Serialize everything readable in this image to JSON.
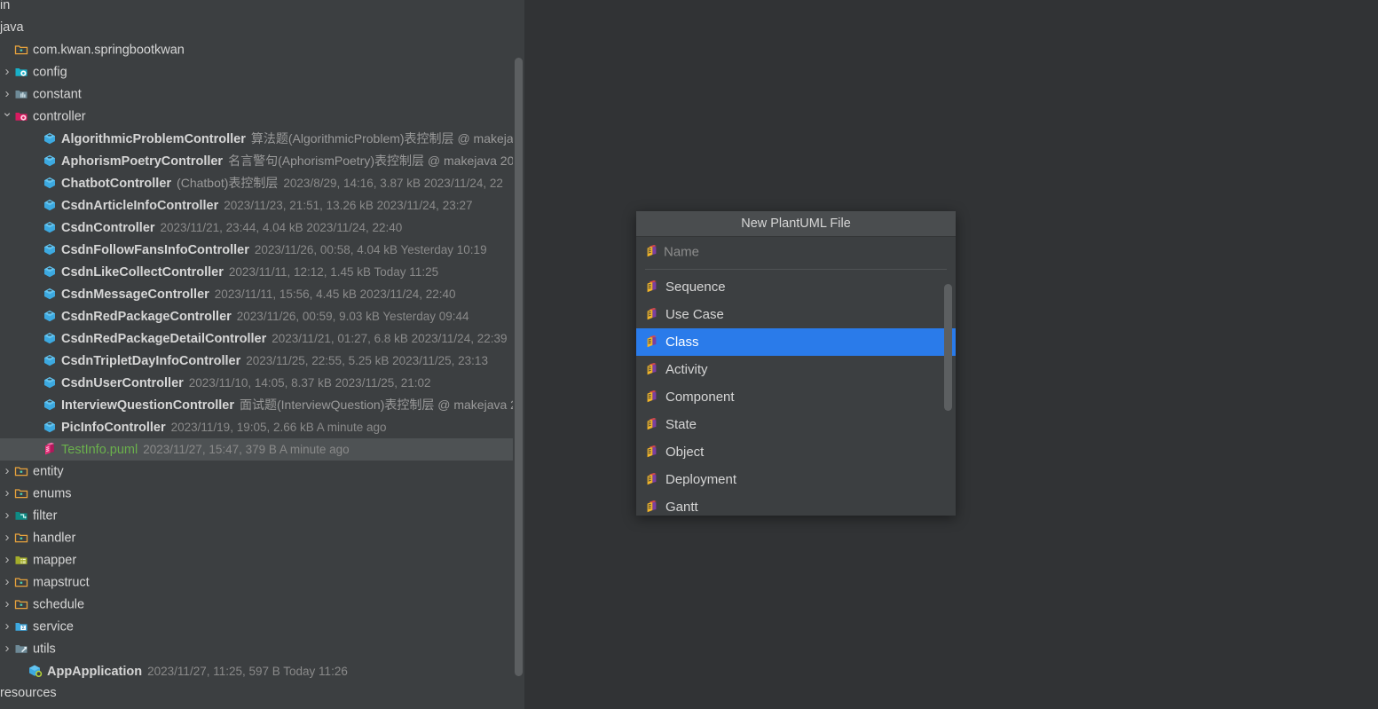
{
  "colors": {
    "panel_bg": "#3c3f41",
    "editor_bg": "#313335",
    "selection_row": "#4e5254",
    "dialog_title_bg": "#4a4d4f",
    "accent_selection": "#2a7bea",
    "text": "#d6d6d6",
    "meta_text": "#8a8a8a",
    "puml_green": "#6ab04c"
  },
  "tree": {
    "top_rows": [
      {
        "label": "in",
        "kind": "plain-clipped"
      },
      {
        "label": "java",
        "kind": "plain"
      }
    ],
    "root": {
      "label": "com.kwan.springbootkwan",
      "icon": "package-folder-icon"
    },
    "packages": [
      {
        "label": "config",
        "icon": "config-folder-icon",
        "arrow": "chevron-right-icon",
        "expanded": false
      },
      {
        "label": "constant",
        "icon": "constant-folder-icon",
        "arrow": "chevron-right-icon",
        "expanded": false
      },
      {
        "label": "controller",
        "icon": "controller-folder-icon",
        "arrow": "chevron-down-icon",
        "expanded": true
      }
    ],
    "controller_files": [
      {
        "name": "AlgorithmicProblemController",
        "icon": "java-class-icon",
        "desc": "算法题(AlgorithmicProblem)表控制层 @ makejav",
        "meta": ""
      },
      {
        "name": "AphorismPoetryController",
        "icon": "java-class-icon",
        "desc": "名言警句(AphorismPoetry)表控制层 @ makejava  20",
        "meta": ""
      },
      {
        "name": "ChatbotController",
        "icon": "java-class-icon",
        "desc": "(Chatbot)表控制层",
        "meta": "2023/8/29, 14:16, 3.87 kB 2023/11/24, 22"
      },
      {
        "name": "CsdnArticleInfoController",
        "icon": "java-class-icon",
        "desc": "",
        "meta": "2023/11/23, 21:51, 13.26 kB 2023/11/24, 23:27"
      },
      {
        "name": "CsdnController",
        "icon": "java-class-icon",
        "desc": "",
        "meta": "2023/11/21, 23:44, 4.04 kB 2023/11/24, 22:40"
      },
      {
        "name": "CsdnFollowFansInfoController",
        "icon": "java-class-icon",
        "desc": "",
        "meta": "2023/11/26, 00:58, 4.04 kB Yesterday 10:19"
      },
      {
        "name": "CsdnLikeCollectController",
        "icon": "java-class-icon",
        "desc": "",
        "meta": "2023/11/11, 12:12, 1.45 kB Today 11:25"
      },
      {
        "name": "CsdnMessageController",
        "icon": "java-class-icon",
        "desc": "",
        "meta": "2023/11/11, 15:56, 4.45 kB 2023/11/24, 22:40"
      },
      {
        "name": "CsdnRedPackageController",
        "icon": "java-class-icon",
        "desc": "",
        "meta": "2023/11/26, 00:59, 9.03 kB Yesterday 09:44"
      },
      {
        "name": "CsdnRedPackageDetailController",
        "icon": "java-class-icon",
        "desc": "",
        "meta": "2023/11/21, 01:27, 6.8 kB 2023/11/24, 22:39"
      },
      {
        "name": "CsdnTripletDayInfoController",
        "icon": "java-class-icon",
        "desc": "",
        "meta": "2023/11/25, 22:55, 5.25 kB 2023/11/25, 23:13"
      },
      {
        "name": "CsdnUserController",
        "icon": "java-class-icon",
        "desc": "",
        "meta": "2023/11/10, 14:05, 8.37 kB 2023/11/25, 21:02"
      },
      {
        "name": "InterviewQuestionController",
        "icon": "java-class-icon",
        "desc": "面试题(InterviewQuestion)表控制层 @ makejava  2",
        "meta": ""
      },
      {
        "name": "PicInfoController",
        "icon": "java-class-icon",
        "desc": "",
        "meta": "2023/11/19, 19:05, 2.66 kB A minute ago"
      }
    ],
    "selected_file": {
      "name": "TestInfo.puml",
      "icon": "plantuml-file-icon",
      "meta": "2023/11/27, 15:47, 379 B A minute ago",
      "selected": true
    },
    "bottom_packages": [
      {
        "label": "entity",
        "icon": "package-folder-icon",
        "arrow": "chevron-right-icon"
      },
      {
        "label": "enums",
        "icon": "package-folder-icon",
        "arrow": "chevron-right-icon"
      },
      {
        "label": "filter",
        "icon": "filter-folder-icon",
        "arrow": "chevron-right-icon"
      },
      {
        "label": "handler",
        "icon": "package-folder-icon",
        "arrow": "chevron-right-icon"
      },
      {
        "label": "mapper",
        "icon": "mapper-folder-icon",
        "arrow": "chevron-right-icon"
      },
      {
        "label": "mapstruct",
        "icon": "package-folder-icon",
        "arrow": "chevron-right-icon"
      },
      {
        "label": "schedule",
        "icon": "package-folder-icon",
        "arrow": "chevron-right-icon"
      },
      {
        "label": "service",
        "icon": "service-folder-icon",
        "arrow": "chevron-right-icon"
      },
      {
        "label": "utils",
        "icon": "utils-folder-icon",
        "arrow": "chevron-right-icon"
      }
    ],
    "app_file": {
      "name": "AppApplication",
      "icon": "spring-boot-class-icon",
      "meta": "2023/11/27, 11:25, 597 B Today 11:26"
    },
    "resources_row": {
      "label": "resources"
    }
  },
  "dialog": {
    "title": "New PlantUML File",
    "name_field": {
      "placeholder": "Name",
      "value": "",
      "icon": "plantuml-file-icon"
    },
    "items": [
      {
        "label": "Sequence",
        "icon": "plantuml-file-icon",
        "selected": false
      },
      {
        "label": "Use Case",
        "icon": "plantuml-file-icon",
        "selected": false
      },
      {
        "label": "Class",
        "icon": "plantuml-file-icon",
        "selected": true
      },
      {
        "label": "Activity",
        "icon": "plantuml-file-icon",
        "selected": false
      },
      {
        "label": "Component",
        "icon": "plantuml-file-icon",
        "selected": false
      },
      {
        "label": "State",
        "icon": "plantuml-file-icon",
        "selected": false
      },
      {
        "label": "Object",
        "icon": "plantuml-file-icon",
        "selected": false
      },
      {
        "label": "Deployment",
        "icon": "plantuml-file-icon",
        "selected": false
      },
      {
        "label": "Gantt",
        "icon": "plantuml-file-icon",
        "selected": false
      }
    ]
  }
}
